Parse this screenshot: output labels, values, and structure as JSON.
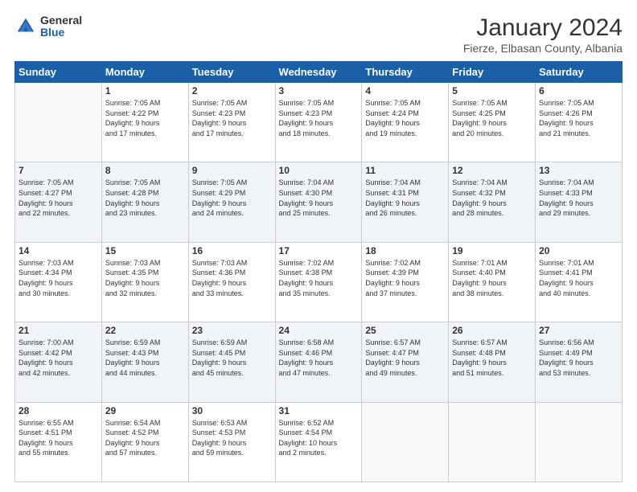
{
  "header": {
    "logo_general": "General",
    "logo_blue": "Blue",
    "month_title": "January 2024",
    "location": "Fierze, Elbasan County, Albania"
  },
  "days_of_week": [
    "Sunday",
    "Monday",
    "Tuesday",
    "Wednesday",
    "Thursday",
    "Friday",
    "Saturday"
  ],
  "weeks": [
    [
      {
        "day": "",
        "text": ""
      },
      {
        "day": "1",
        "text": "Sunrise: 7:05 AM\nSunset: 4:22 PM\nDaylight: 9 hours\nand 17 minutes."
      },
      {
        "day": "2",
        "text": "Sunrise: 7:05 AM\nSunset: 4:23 PM\nDaylight: 9 hours\nand 17 minutes."
      },
      {
        "day": "3",
        "text": "Sunrise: 7:05 AM\nSunset: 4:23 PM\nDaylight: 9 hours\nand 18 minutes."
      },
      {
        "day": "4",
        "text": "Sunrise: 7:05 AM\nSunset: 4:24 PM\nDaylight: 9 hours\nand 19 minutes."
      },
      {
        "day": "5",
        "text": "Sunrise: 7:05 AM\nSunset: 4:25 PM\nDaylight: 9 hours\nand 20 minutes."
      },
      {
        "day": "6",
        "text": "Sunrise: 7:05 AM\nSunset: 4:26 PM\nDaylight: 9 hours\nand 21 minutes."
      }
    ],
    [
      {
        "day": "7",
        "text": "Sunrise: 7:05 AM\nSunset: 4:27 PM\nDaylight: 9 hours\nand 22 minutes."
      },
      {
        "day": "8",
        "text": "Sunrise: 7:05 AM\nSunset: 4:28 PM\nDaylight: 9 hours\nand 23 minutes."
      },
      {
        "day": "9",
        "text": "Sunrise: 7:05 AM\nSunset: 4:29 PM\nDaylight: 9 hours\nand 24 minutes."
      },
      {
        "day": "10",
        "text": "Sunrise: 7:04 AM\nSunset: 4:30 PM\nDaylight: 9 hours\nand 25 minutes."
      },
      {
        "day": "11",
        "text": "Sunrise: 7:04 AM\nSunset: 4:31 PM\nDaylight: 9 hours\nand 26 minutes."
      },
      {
        "day": "12",
        "text": "Sunrise: 7:04 AM\nSunset: 4:32 PM\nDaylight: 9 hours\nand 28 minutes."
      },
      {
        "day": "13",
        "text": "Sunrise: 7:04 AM\nSunset: 4:33 PM\nDaylight: 9 hours\nand 29 minutes."
      }
    ],
    [
      {
        "day": "14",
        "text": "Sunrise: 7:03 AM\nSunset: 4:34 PM\nDaylight: 9 hours\nand 30 minutes."
      },
      {
        "day": "15",
        "text": "Sunrise: 7:03 AM\nSunset: 4:35 PM\nDaylight: 9 hours\nand 32 minutes."
      },
      {
        "day": "16",
        "text": "Sunrise: 7:03 AM\nSunset: 4:36 PM\nDaylight: 9 hours\nand 33 minutes."
      },
      {
        "day": "17",
        "text": "Sunrise: 7:02 AM\nSunset: 4:38 PM\nDaylight: 9 hours\nand 35 minutes."
      },
      {
        "day": "18",
        "text": "Sunrise: 7:02 AM\nSunset: 4:39 PM\nDaylight: 9 hours\nand 37 minutes."
      },
      {
        "day": "19",
        "text": "Sunrise: 7:01 AM\nSunset: 4:40 PM\nDaylight: 9 hours\nand 38 minutes."
      },
      {
        "day": "20",
        "text": "Sunrise: 7:01 AM\nSunset: 4:41 PM\nDaylight: 9 hours\nand 40 minutes."
      }
    ],
    [
      {
        "day": "21",
        "text": "Sunrise: 7:00 AM\nSunset: 4:42 PM\nDaylight: 9 hours\nand 42 minutes."
      },
      {
        "day": "22",
        "text": "Sunrise: 6:59 AM\nSunset: 4:43 PM\nDaylight: 9 hours\nand 44 minutes."
      },
      {
        "day": "23",
        "text": "Sunrise: 6:59 AM\nSunset: 4:45 PM\nDaylight: 9 hours\nand 45 minutes."
      },
      {
        "day": "24",
        "text": "Sunrise: 6:58 AM\nSunset: 4:46 PM\nDaylight: 9 hours\nand 47 minutes."
      },
      {
        "day": "25",
        "text": "Sunrise: 6:57 AM\nSunset: 4:47 PM\nDaylight: 9 hours\nand 49 minutes."
      },
      {
        "day": "26",
        "text": "Sunrise: 6:57 AM\nSunset: 4:48 PM\nDaylight: 9 hours\nand 51 minutes."
      },
      {
        "day": "27",
        "text": "Sunrise: 6:56 AM\nSunset: 4:49 PM\nDaylight: 9 hours\nand 53 minutes."
      }
    ],
    [
      {
        "day": "28",
        "text": "Sunrise: 6:55 AM\nSunset: 4:51 PM\nDaylight: 9 hours\nand 55 minutes."
      },
      {
        "day": "29",
        "text": "Sunrise: 6:54 AM\nSunset: 4:52 PM\nDaylight: 9 hours\nand 57 minutes."
      },
      {
        "day": "30",
        "text": "Sunrise: 6:53 AM\nSunset: 4:53 PM\nDaylight: 9 hours\nand 59 minutes."
      },
      {
        "day": "31",
        "text": "Sunrise: 6:52 AM\nSunset: 4:54 PM\nDaylight: 10 hours\nand 2 minutes."
      },
      {
        "day": "",
        "text": ""
      },
      {
        "day": "",
        "text": ""
      },
      {
        "day": "",
        "text": ""
      }
    ]
  ]
}
